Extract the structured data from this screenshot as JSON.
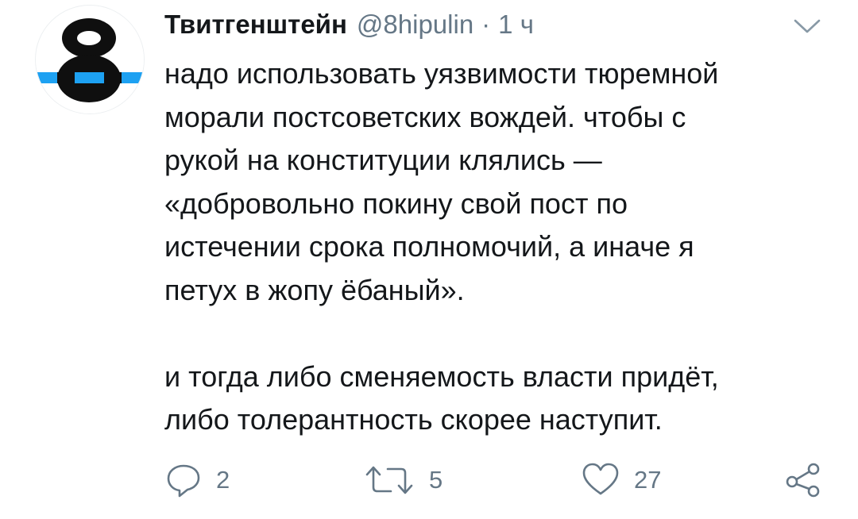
{
  "author": {
    "avatar_glyph": "8",
    "display_name": "Твитгенштейн",
    "handle": "@8hipulin",
    "separator": "·",
    "time": "1 ч"
  },
  "tweet": {
    "lines": [
      "надо использовать уязвимости тюремной",
      "морали постсоветских вождей. чтобы с",
      "рукой на конституции клялись —",
      "«добровольно покину свой пост по",
      "истечении срока полномочий, а иначе я",
      "петух в жопу ёбаный»."
    ],
    "lines_2": [
      "и тогда либо сменяемость власти придёт,",
      "либо толерантность скорее наступит."
    ]
  },
  "actions": {
    "reply_count": "2",
    "retweet_count": "5",
    "like_count": "27"
  },
  "icons": {
    "menu": "chevron-down-icon",
    "reply": "reply-icon",
    "retweet": "retweet-icon",
    "like": "heart-icon",
    "share": "share-icon"
  },
  "colors": {
    "text": "#14171a",
    "muted": "#657786",
    "avatar_accent": "#1da1f2",
    "avatar_dark": "#0f0f0f"
  }
}
